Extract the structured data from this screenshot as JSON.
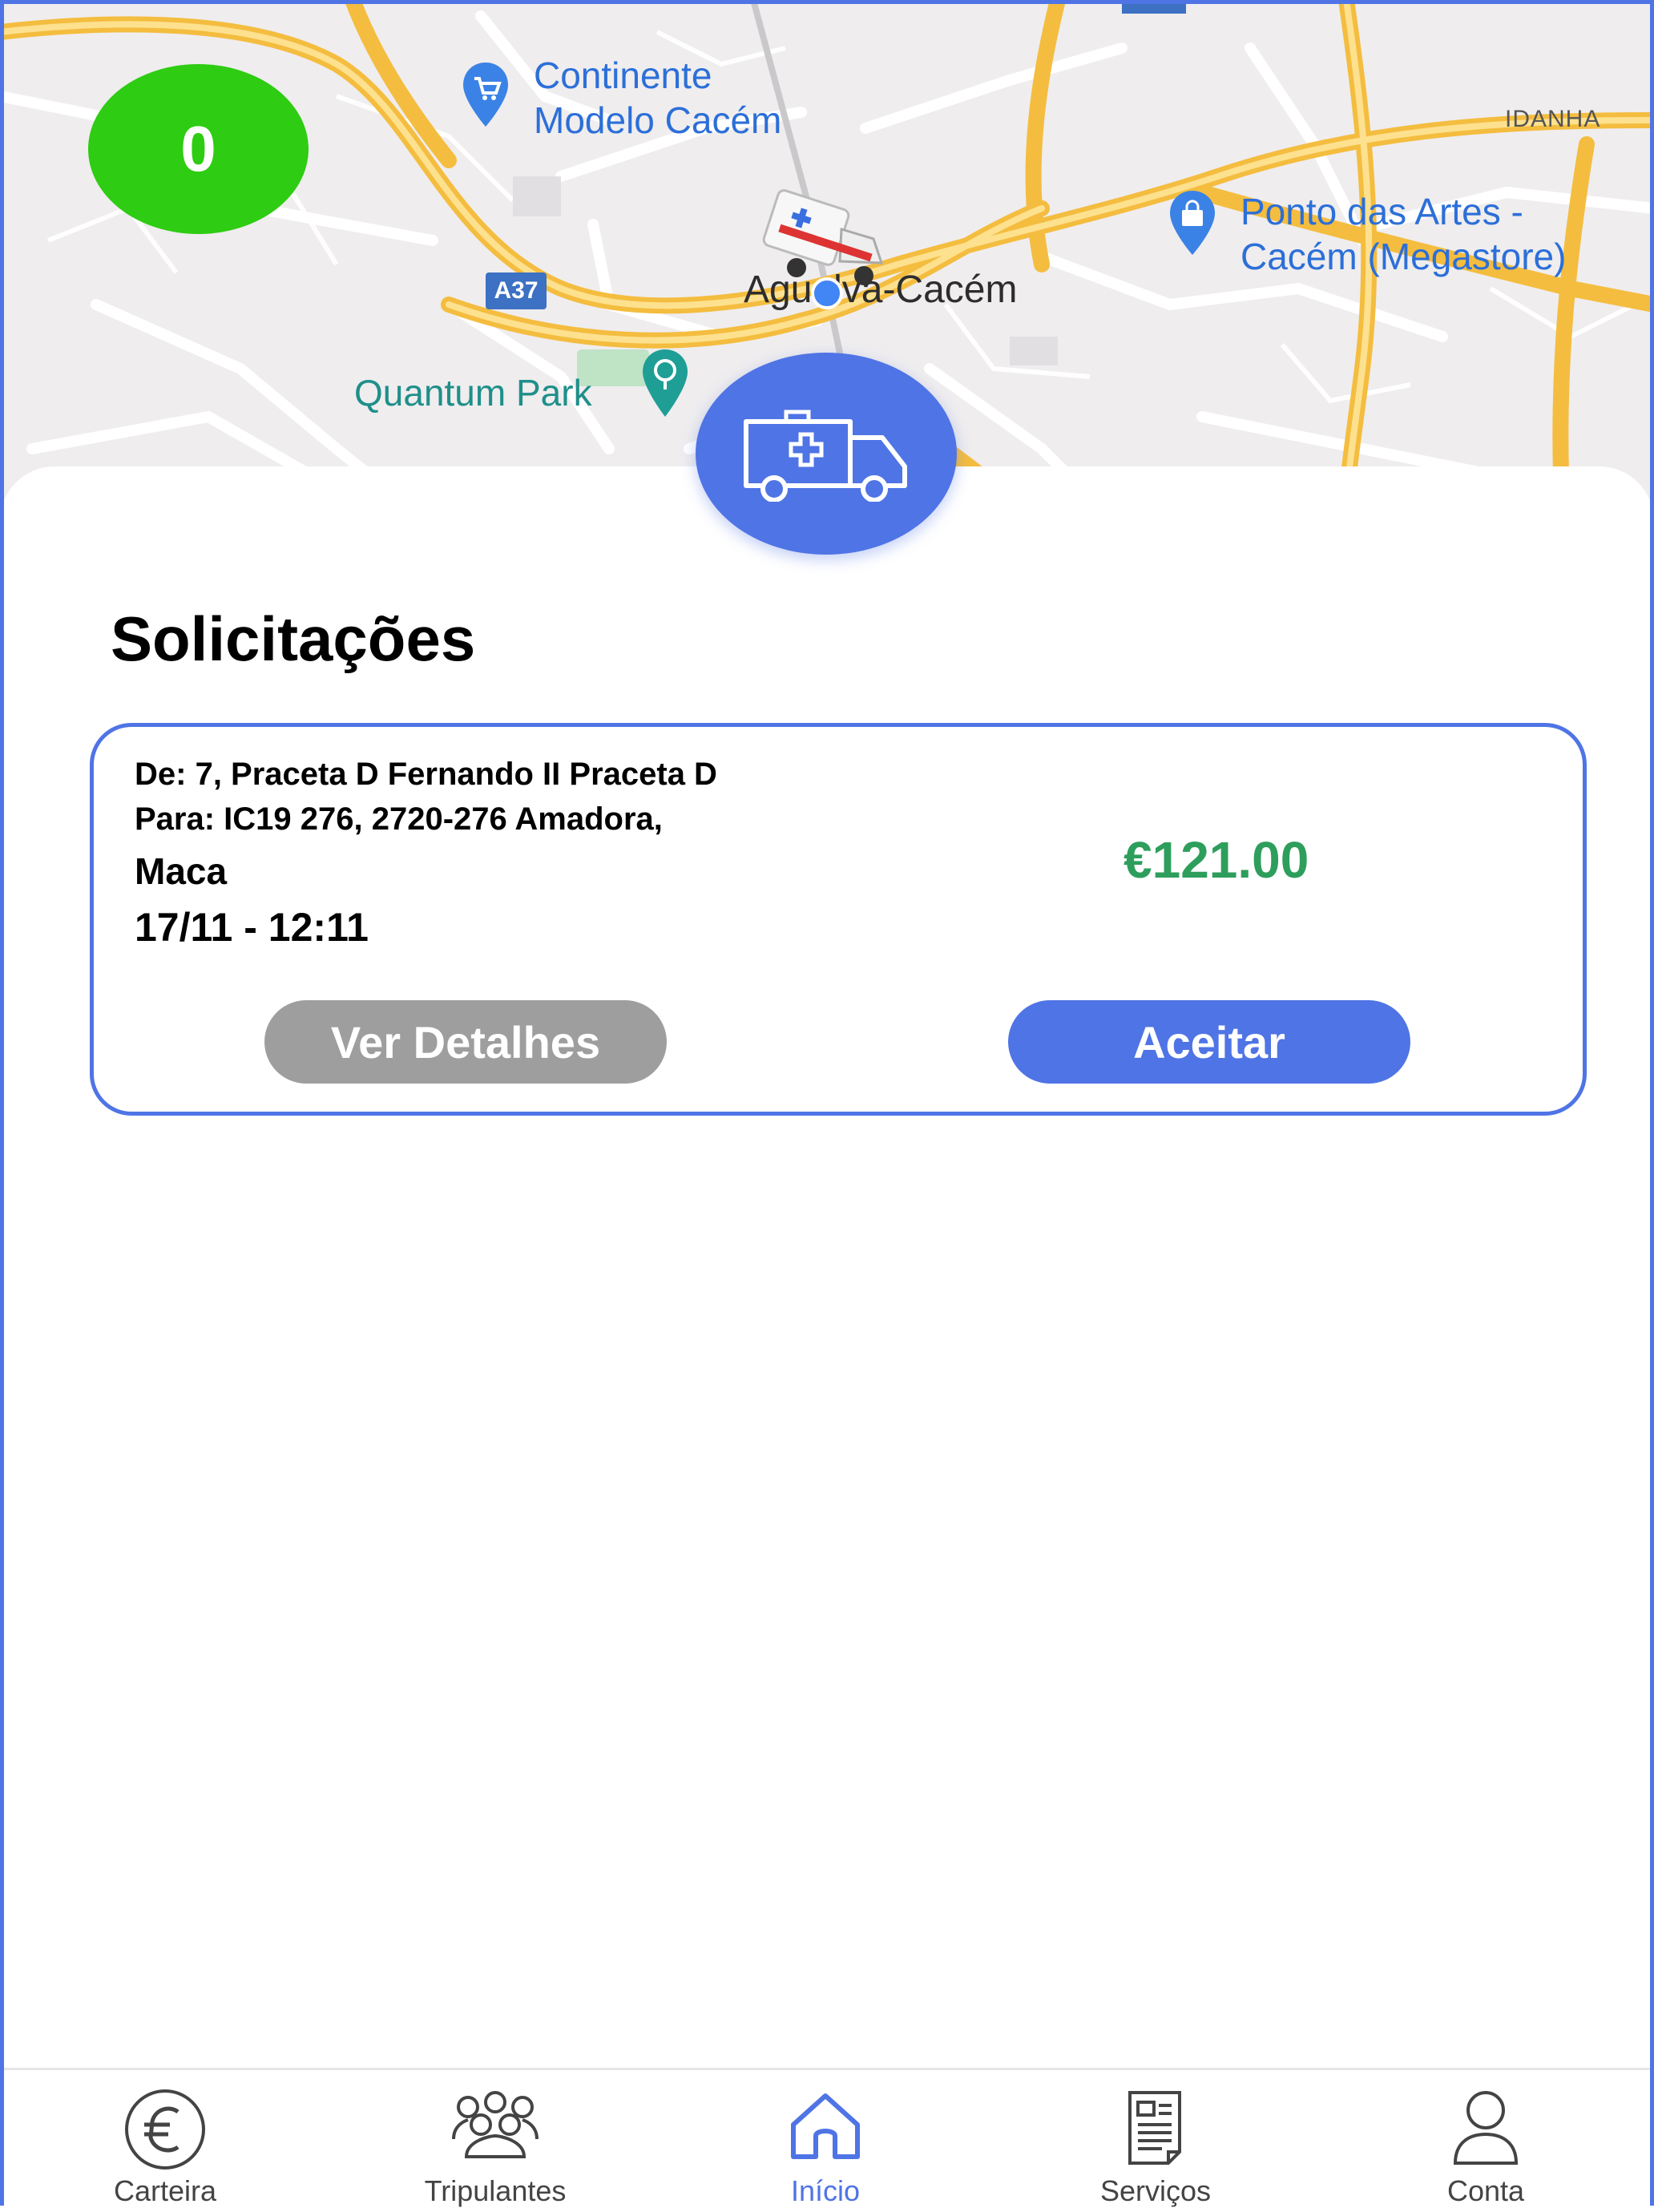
{
  "map": {
    "online_count": "0",
    "highway_shield": "A37",
    "places": {
      "continente": [
        "Continente",
        "Modelo Cacém"
      ],
      "ponto_artes": [
        "Ponto das Artes -",
        "Cacém (Megastore)"
      ],
      "quantum": "Quantum Park",
      "agualva": "Agualva-Cacém",
      "idanha": "IDANHA"
    }
  },
  "section_title": "Solicitações",
  "request": {
    "from": "De: 7, Praceta D Fernando II Praceta D",
    "to": "Para: IC19 276, 2720-276 Amadora,",
    "type": "Maca",
    "datetime": "17/11 - 12:11",
    "price": "€121.00",
    "details_label": "Ver Detalhes",
    "accept_label": "Aceitar"
  },
  "nav": {
    "items": [
      {
        "label": "Carteira",
        "icon": "euro-wallet-icon"
      },
      {
        "label": "Tripulantes",
        "icon": "crew-icon"
      },
      {
        "label": "Início",
        "icon": "home-icon",
        "active": true
      },
      {
        "label": "Serviços",
        "icon": "document-icon"
      },
      {
        "label": "Conta",
        "icon": "person-icon"
      }
    ]
  },
  "colors": {
    "accent": "#4f74e5",
    "online": "#2ecc12",
    "price": "#2e9e5c",
    "secondary_button": "#9e9e9e"
  }
}
